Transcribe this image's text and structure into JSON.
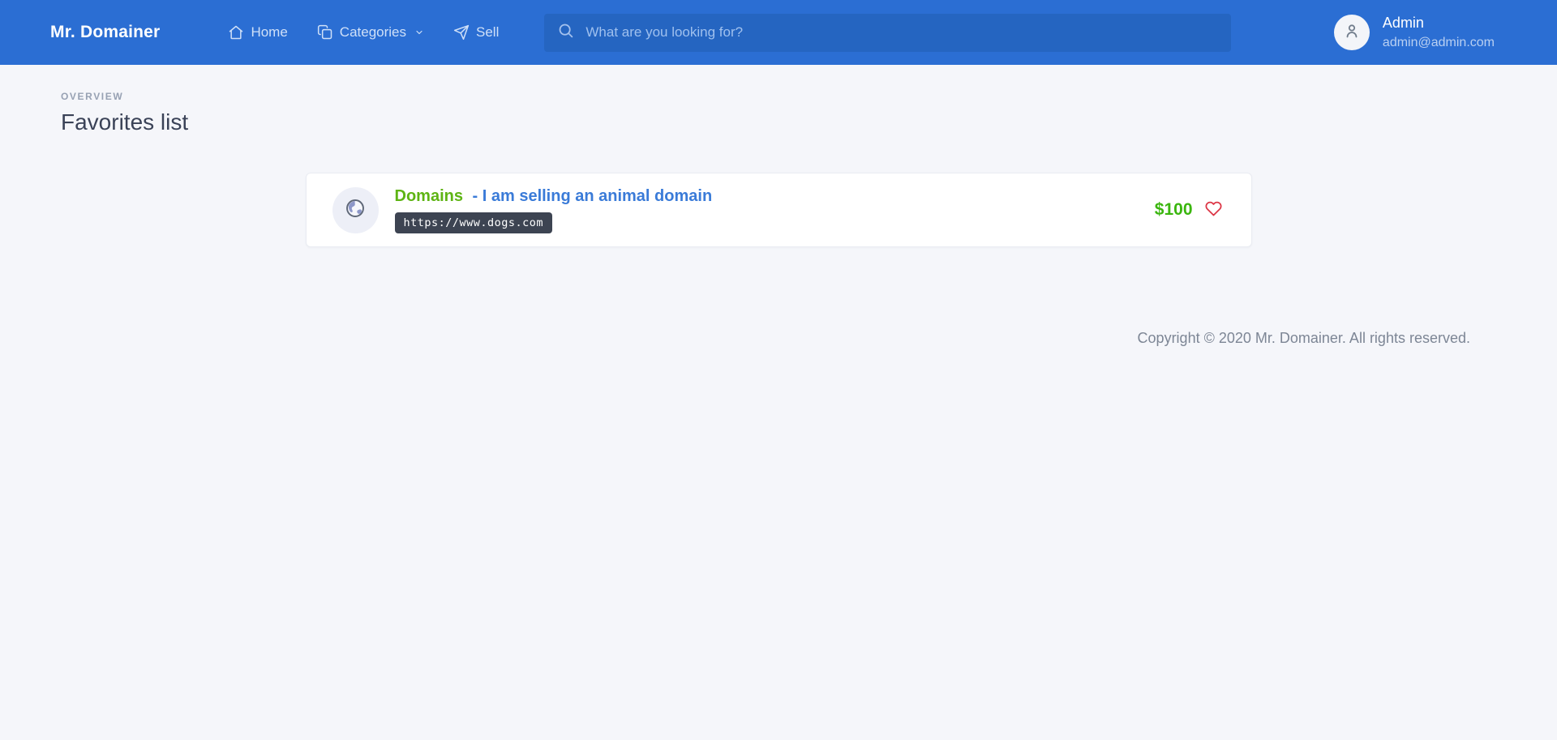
{
  "header": {
    "brand": "Mr. Domainer",
    "nav": [
      {
        "label": "Home",
        "icon": "home-icon"
      },
      {
        "label": "Categories",
        "icon": "categories-icon"
      },
      {
        "label": "Sell",
        "icon": "send-icon"
      }
    ],
    "search_placeholder": "What are you looking for?",
    "user": {
      "name": "Admin",
      "email": "admin@admin.com"
    }
  },
  "overview_label": "OVERVIEW",
  "page_title": "Favorites list",
  "favorites": [
    {
      "category": "Domains",
      "title_rest": "- I am selling an animal domain",
      "url": "https://www.dogs.com",
      "price": "$100"
    }
  ],
  "footer_text": "Copyright © 2020 Mr. Domainer. All rights reserved.",
  "colors": {
    "header_blue": "#2b6ed3",
    "search_blue": "#2565c1",
    "category_green": "#5eb414",
    "price_green": "#3bb60f",
    "link_blue": "#3a7bd8",
    "badge_dark": "#3d4452",
    "heart_red": "#dc3545",
    "page_bg": "#f5f6fa"
  }
}
